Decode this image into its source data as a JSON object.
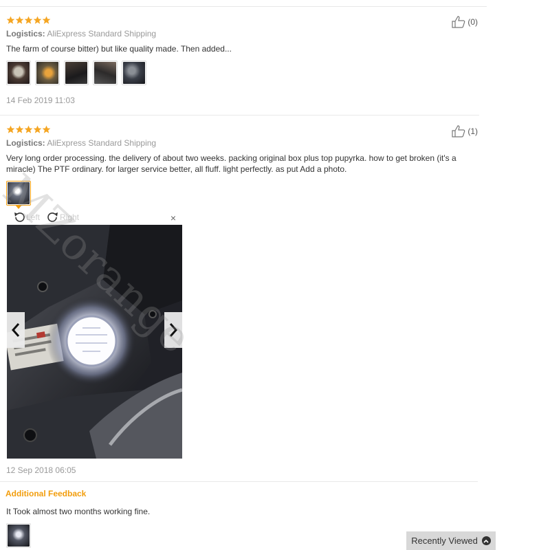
{
  "reviews": [
    {
      "rating": 5,
      "logistics_label": "Logistics:",
      "logistics_value": "AliExpress Standard Shipping",
      "text": "The farm of course bitter) but like quality made. Then added...",
      "helpful_count": "(0)",
      "photo_count": 5,
      "date": "14 Feb 2019 11:03"
    },
    {
      "rating": 5,
      "logistics_label": "Logistics:",
      "logistics_value": "AliExpress Standard Shipping",
      "text": "Very long order processing. the delivery of about two weeks. packing original box plus top pupyrka. how to get broken (it's a miracle) The PTF ordinary. for larger service better, all fluff. light perfectly. as put Add a photo.",
      "helpful_count": "(1)",
      "photo_count": 1,
      "date": "12 Sep 2018 06:05"
    }
  ],
  "viewer": {
    "rotate_left": "Left",
    "rotate_right": "Right",
    "close": "×"
  },
  "additional_feedback": {
    "title": "Additional Feedback",
    "text": "It Took almost two months working fine."
  },
  "watermark": "MZorange",
  "recently_viewed": "Recently Viewed",
  "colors": {
    "star": "#f5a623",
    "accent": "#f29d0c"
  }
}
